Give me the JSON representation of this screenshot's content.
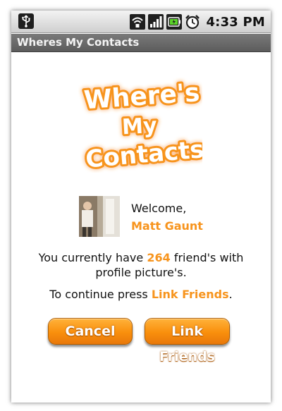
{
  "status_bar": {
    "time": "4:33 PM",
    "icons": [
      "usb-icon",
      "wifi-icon",
      "signal-icon",
      "battery-icon",
      "alarm-icon"
    ]
  },
  "title_bar": {
    "title": "Wheres My Contacts"
  },
  "logo": {
    "line1": "Where's",
    "line2": "My",
    "line3": "Contacts"
  },
  "profile": {
    "welcome": "Welcome,",
    "name": "Matt Gaunt"
  },
  "message": {
    "prefix": "You currently have ",
    "count": "264",
    "suffix": " friend's with",
    "line2": "profile picture's.",
    "continue_prefix": "To continue press ",
    "continue_action": "Link Friends",
    "continue_suffix": "."
  },
  "buttons": {
    "cancel": "Cancel",
    "link_friends": "Link Friends"
  },
  "colors": {
    "accent": "#f7941d",
    "button": "#f98f0c",
    "title_bar": "#6a6a6a"
  }
}
